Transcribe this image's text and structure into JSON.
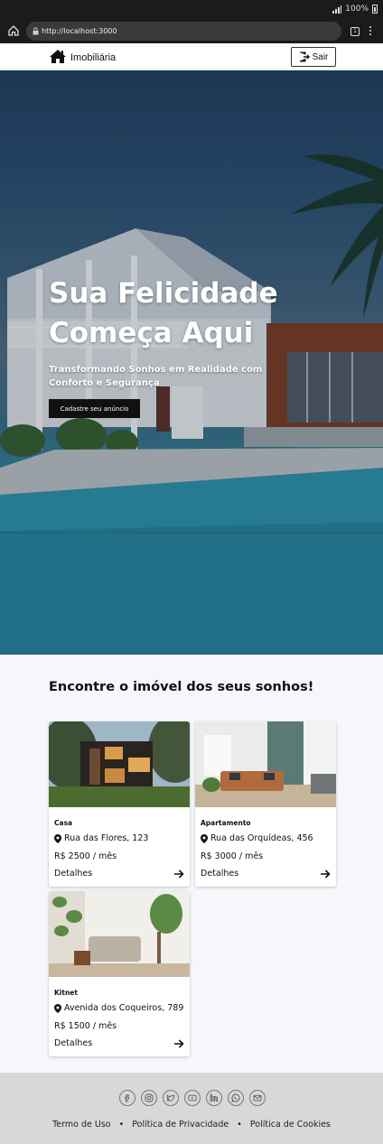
{
  "status_bar": {
    "battery": "100%"
  },
  "browser": {
    "url": "http://localhost:3000",
    "tab_count": "1"
  },
  "header": {
    "brand": "Imobiliária",
    "logout_label": "Sair"
  },
  "hero": {
    "title": "Sua Felicidade Começa Aqui",
    "subtitle": "Transformando Sonhos em Realidade com Conforto e Segurança",
    "cta_label": "Cadastre seu anúncio"
  },
  "listings": {
    "title": "Encontre o imóvel dos seus sonhos!",
    "cards": [
      {
        "type": "Casa",
        "address": "Rua das Flores, 123",
        "price": "R$ 2500 / mês",
        "details": "Detalhes"
      },
      {
        "type": "Apartamento",
        "address": "Rua das Orquídeas, 456",
        "price": "R$ 3000 / mês",
        "details": "Detalhes"
      },
      {
        "type": "Kitnet",
        "address": "Avenida dos Coqueiros, 789",
        "price": "R$ 1500 / mês",
        "details": "Detalhes"
      }
    ]
  },
  "footer": {
    "social_icons": [
      "facebook-icon",
      "instagram-icon",
      "twitter-icon",
      "youtube-icon",
      "linkedin-icon",
      "whatsapp-icon",
      "email-icon"
    ],
    "links": [
      "Termo de Uso",
      "Política de Privacidade",
      "Política de Cookies"
    ],
    "separator": "•"
  }
}
